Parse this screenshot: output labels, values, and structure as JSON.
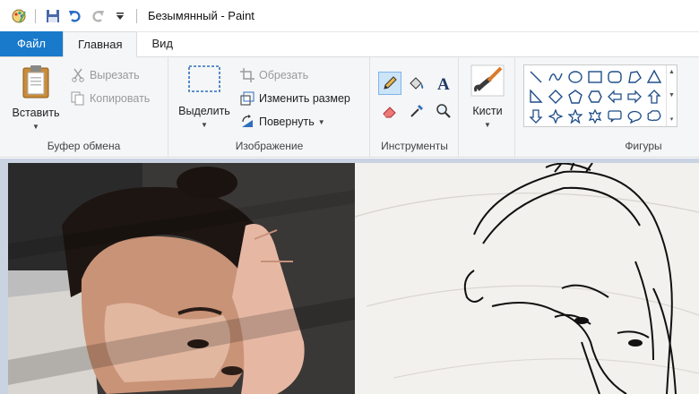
{
  "window": {
    "title": "Безымянный - Paint"
  },
  "quick_access": {
    "icons": [
      "paint-app-icon",
      "save-icon",
      "undo-icon",
      "redo-icon",
      "customize-dropdown-icon"
    ]
  },
  "tabs": [
    {
      "label": "Файл"
    },
    {
      "label": "Главная"
    },
    {
      "label": "Вид"
    }
  ],
  "ribbon": {
    "clipboard": {
      "paste_label": "Вставить",
      "cut_label": "Вырезать",
      "copy_label": "Копировать",
      "group_label": "Буфер обмена"
    },
    "image": {
      "select_label": "Выделить",
      "crop_label": "Обрезать",
      "resize_label": "Изменить размер",
      "rotate_label": "Повернуть",
      "group_label": "Изображение"
    },
    "tools": {
      "group_label": "Инструменты",
      "items": [
        "pencil-icon",
        "fill-icon",
        "text-icon",
        "eraser-icon",
        "color-picker-icon",
        "magnifier-icon"
      ]
    },
    "brushes": {
      "label": "Кисти"
    },
    "shapes": {
      "group_label": "Фигуры",
      "items": [
        "line",
        "curve",
        "oval",
        "rectangle",
        "rounded-rectangle",
        "polygon",
        "triangle",
        "right-triangle",
        "diamond",
        "pentagon",
        "hexagon",
        "left-arrow",
        "right-arrow",
        "up-arrow",
        "down-arrow",
        "four-point-star",
        "five-point-star",
        "six-point-star",
        "rounded-callout",
        "oval-callout",
        "cloud-callout"
      ]
    }
  },
  "colors": {
    "accent": "#1979ca",
    "ribbon_bg": "#f5f6f7",
    "workspace_bg": "#c9d3e2"
  }
}
